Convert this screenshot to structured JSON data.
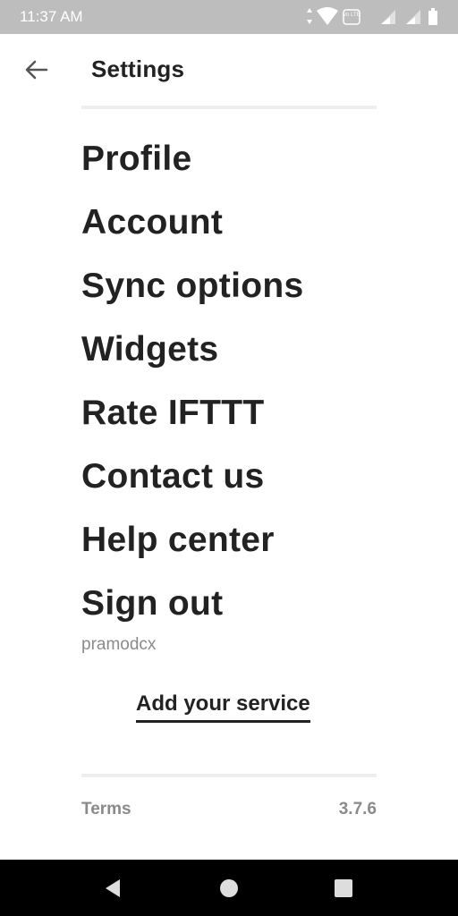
{
  "status_bar": {
    "time": "11:37 AM",
    "icons": [
      "data-arrows-icon",
      "wifi-icon",
      "volte-icon",
      "signal-icon",
      "signal-icon",
      "battery-icon"
    ],
    "volte_label": "Vo LTE"
  },
  "header": {
    "title": "Settings",
    "back_icon": "arrow-left-icon"
  },
  "menu": {
    "items": [
      {
        "label": "Profile"
      },
      {
        "label": "Account"
      },
      {
        "label": "Sync options"
      },
      {
        "label": "Widgets"
      },
      {
        "label": "Rate IFTTT"
      },
      {
        "label": "Contact us"
      },
      {
        "label": "Help center"
      },
      {
        "label": "Sign out"
      }
    ],
    "username": "pramodcx"
  },
  "add_service": {
    "label": "Add your service"
  },
  "footer": {
    "terms": "Terms",
    "version": "3.7.6"
  },
  "nav_bar": {
    "icons": [
      "back-triangle-icon",
      "home-circle-icon",
      "recents-square-icon"
    ]
  }
}
